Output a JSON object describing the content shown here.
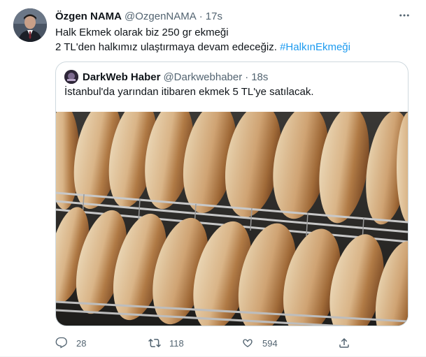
{
  "tweet": {
    "author_name": "Özgen NAMA",
    "author_handle": "@OzgenNAMA",
    "separator": "·",
    "time": "17s",
    "text_line1": "Halk Ekmek olarak biz 250 gr ekmeği",
    "text_line2": "2 TL'den halkımız ulaştırmaya devam edeceğiz.",
    "hashtag": "#HalkınEkmeği"
  },
  "quote": {
    "author_name": "DarkWeb Haber",
    "author_handle": "@Darkwebhaber",
    "separator": "·",
    "time": "18s",
    "text": "İstanbul'da yarından itibaren ekmek 5 TL'ye satılacak."
  },
  "actions": {
    "reply_count": "28",
    "retweet_count": "118",
    "like_count": "594"
  },
  "colors": {
    "accent": "#1d9bf0",
    "secondary_text": "#536471",
    "border": "#cfd9de"
  },
  "icons": [
    "more-icon",
    "reply-icon",
    "retweet-icon",
    "like-icon",
    "share-icon"
  ]
}
